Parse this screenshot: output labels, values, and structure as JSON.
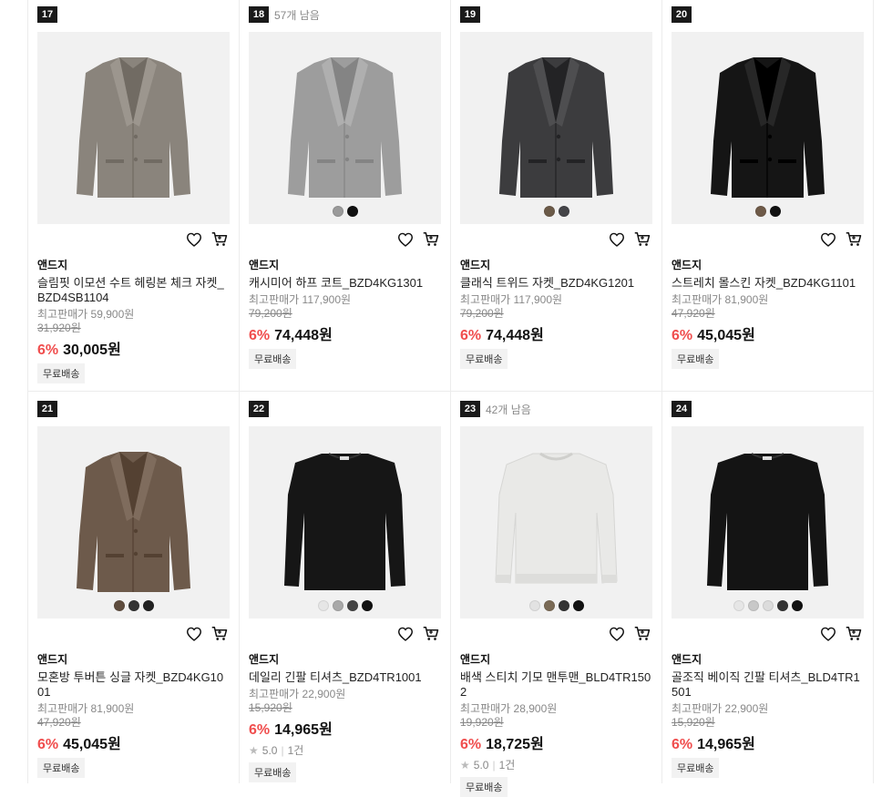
{
  "products": [
    {
      "rank": "17",
      "stock": "",
      "brand": "앤드지",
      "name": "슬림핏 이모션 수트 헤링본 체크 자켓_BZD4SB1104",
      "max_price": "최고판매가 59,900원",
      "original": "31,920원",
      "discount": "6%",
      "price": "30,005원",
      "rating": "",
      "reviews": "",
      "badge": "무료배송",
      "kind": "jacket",
      "color": "#8a847c",
      "swatches": []
    },
    {
      "rank": "18",
      "stock": "57개 남음",
      "brand": "앤드지",
      "name": "캐시미어 하프 코트_BZD4KG1301",
      "max_price": "최고판매가 117,900원",
      "original": "79,200원",
      "discount": "6%",
      "price": "74,448원",
      "rating": "",
      "reviews": "",
      "badge": "무료배송",
      "kind": "jacket",
      "color": "#9d9d9d",
      "swatches": [
        "#9a9a9a",
        "#111111"
      ]
    },
    {
      "rank": "19",
      "stock": "",
      "brand": "앤드지",
      "name": "클래식 트위드 자켓_BZD4KG1201",
      "max_price": "최고판매가 117,900원",
      "original": "79,200원",
      "discount": "6%",
      "price": "74,448원",
      "rating": "",
      "reviews": "",
      "badge": "무료배송",
      "kind": "jacket",
      "color": "#3c3c3e",
      "swatches": [
        "#6b5a48",
        "#444448"
      ]
    },
    {
      "rank": "20",
      "stock": "",
      "brand": "앤드지",
      "name": "스트레치 몰스킨 자켓_BZD4KG1101",
      "max_price": "최고판매가 81,900원",
      "original": "47,920원",
      "discount": "6%",
      "price": "45,045원",
      "rating": "",
      "reviews": "",
      "badge": "무료배송",
      "kind": "jacket",
      "color": "#151515",
      "swatches": [
        "#6e5a48",
        "#111111"
      ]
    },
    {
      "rank": "21",
      "stock": "",
      "brand": "앤드지",
      "name": "모혼방 투버튼 싱글 자켓_BZD4KG1001",
      "max_price": "최고판매가 81,900원",
      "original": "47,920원",
      "discount": "6%",
      "price": "45,045원",
      "rating": "",
      "reviews": "",
      "badge": "무료배송",
      "kind": "jacket",
      "color": "#6d5a4b",
      "swatches": [
        "#5e4c3e",
        "#333333",
        "#222222"
      ]
    },
    {
      "rank": "22",
      "stock": "",
      "brand": "앤드지",
      "name": "데일리 긴팔 티셔츠_BZD4TR1001",
      "max_price": "최고판매가 22,900원",
      "original": "15,920원",
      "discount": "6%",
      "price": "14,965원",
      "rating": "5.0",
      "reviews": "1건",
      "badge": "무료배송",
      "kind": "tee",
      "color": "#161616",
      "swatches": [
        "#e6e6e6",
        "#a9a9a9",
        "#444444",
        "#111111"
      ]
    },
    {
      "rank": "23",
      "stock": "42개 남음",
      "brand": "앤드지",
      "name": "배색 스티치 기모 맨투맨_BLD4TR1502",
      "max_price": "최고판매가 28,900원",
      "original": "19,920원",
      "discount": "6%",
      "price": "18,725원",
      "rating": "5.0",
      "reviews": "1건",
      "badge": "무료배송",
      "kind": "sweat",
      "color": "#e9e9e7",
      "swatches": [
        "#e2e2e2",
        "#7a6a55",
        "#333333",
        "#111111"
      ]
    },
    {
      "rank": "24",
      "stock": "",
      "brand": "앤드지",
      "name": "골조직 베이직 긴팔 티셔츠_BLD4TR1501",
      "max_price": "최고판매가 22,900원",
      "original": "15,920원",
      "discount": "6%",
      "price": "14,965원",
      "rating": "",
      "reviews": "",
      "badge": "무료배송",
      "kind": "tee",
      "color": "#141414",
      "swatches": [
        "#e6e6e6",
        "#c8c8c8",
        "#dcdcdc",
        "#333333",
        "#111111"
      ]
    }
  ]
}
